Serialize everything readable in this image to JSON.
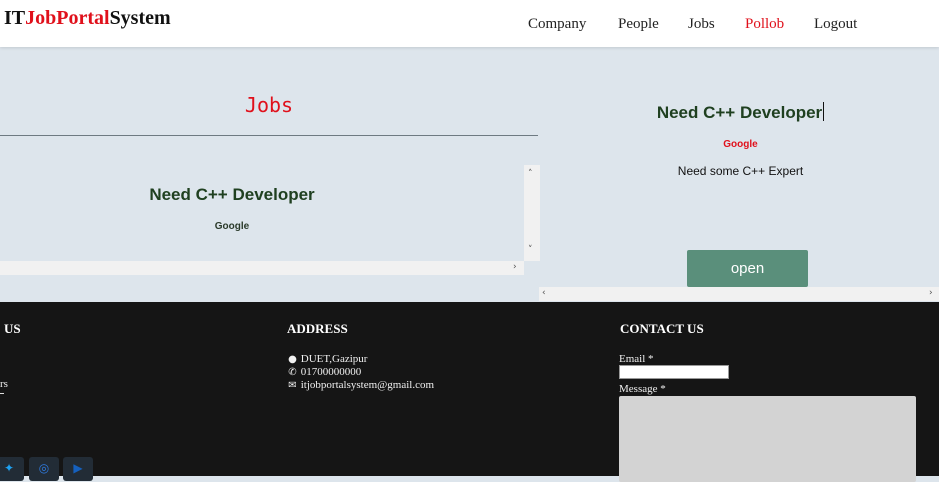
{
  "header": {
    "brand": {
      "part1": "IT",
      "part2": "JobPortal",
      "part3": "System"
    },
    "nav": [
      "Company",
      "People",
      "Jobs",
      "Pollob",
      "Logout"
    ]
  },
  "jobs_panel": {
    "title": "Jobs",
    "list": [
      {
        "title": "Need C++ Developer",
        "company": "Google"
      }
    ]
  },
  "detail_panel": {
    "title": "Need C++ Developer",
    "company": "Google",
    "description": "Need some C++ Expert",
    "open_label": "open"
  },
  "footer": {
    "about_heading": "US",
    "about_fragment": "rs",
    "address_heading": "ADDRESS",
    "address_lines": [
      {
        "icon": "map-marker-icon",
        "text": "DUET,Gazipur"
      },
      {
        "icon": "phone-icon",
        "text": "01700000000"
      },
      {
        "icon": "envelope-icon",
        "text": "itjobportalsystem@gmail.com"
      }
    ],
    "contact_heading": "CONTACT US",
    "email_label": "Email *",
    "message_label": "Message *",
    "social": [
      {
        "icon": "twitter-icon",
        "color": "#1da1f2"
      },
      {
        "icon": "instagram-icon",
        "color": "#2f7be0"
      },
      {
        "icon": "youtube-icon",
        "color": "#1560bd"
      }
    ]
  },
  "colors": {
    "accent_red": "#e0101b",
    "button_green": "#5a8f7b",
    "panel_bg": "#dde5ec",
    "footer_bg": "#151515"
  }
}
